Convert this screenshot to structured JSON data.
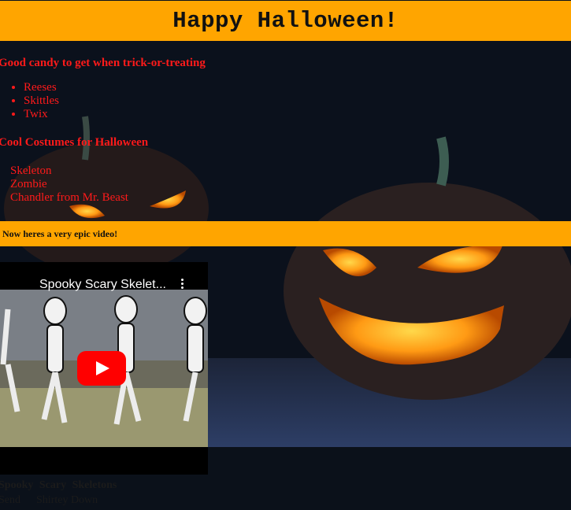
{
  "banner": {
    "title": "Happy Halloween!"
  },
  "candy": {
    "heading": "Good candy to get when trick-or-treating",
    "items": [
      "Reeses",
      "Skittles",
      "Twix"
    ]
  },
  "costumes": {
    "heading": "Cool Costumes for Halloween",
    "items": [
      "Skeleton",
      "Zombie",
      "Chandler from Mr. Beast"
    ]
  },
  "video_bar": {
    "text": "Now heres a very epic video!"
  },
  "video": {
    "title": "Spooky Scary Skelet...",
    "caption_title": "Spooky Scary Skeletons",
    "caption_left": "Send",
    "caption_right": "Shirtey Down"
  },
  "colors": {
    "banner": "#ffa500",
    "heading_text": "#ff1a1a",
    "background": "#0a0e16",
    "play_button": "#ff0000"
  },
  "icons": [
    "more-vertical-icon",
    "play-icon"
  ]
}
